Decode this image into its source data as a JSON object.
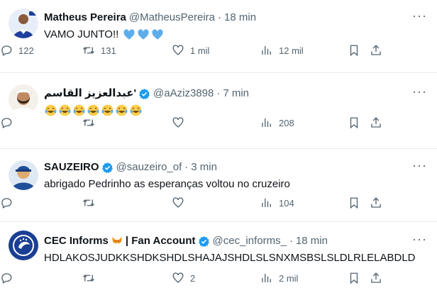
{
  "tweets": [
    {
      "name": "Matheus Pereira",
      "handle": "@MatheusPereira",
      "time": "18 min",
      "text": "VAMO JUNTO!!",
      "emoji": "blue-heart x3",
      "replies": "122",
      "retweets": "131",
      "likes": "1 mil",
      "views": "12 mil",
      "verified": false
    },
    {
      "name": "عبدالعزيز القاسم'",
      "handle": "@aAziz3898",
      "time": "7 min",
      "text": "",
      "emoji": "laughing-tears x7",
      "replies": "",
      "retweets": "",
      "likes": "",
      "views": "208",
      "verified": true
    },
    {
      "name": "SAUZEIRO",
      "handle": "@sauzeiro_of",
      "time": "3 min",
      "text": "abrigado Pedrinho as esperanças voltou no cruzeiro",
      "replies": "",
      "retweets": "",
      "likes": "",
      "views": "104",
      "verified": true
    },
    {
      "name": "CEC Informs",
      "name_suffix": "| Fan Account",
      "handle": "@cec_informs_",
      "time": "18 min",
      "text": "HDLAKOSJUDKKSHDKSHDLSHAJAJSHDLSLSNXMSBSLSLDLRLELABDLD",
      "replies": "",
      "retweets": "",
      "likes": "2",
      "views": "2 mil",
      "verified": true
    }
  ],
  "separator": "·",
  "more": "···",
  "colors": {
    "text": "#0f1419",
    "secondary": "#536471",
    "verified": "#1d9bf0",
    "border": "#e6ecf0"
  }
}
